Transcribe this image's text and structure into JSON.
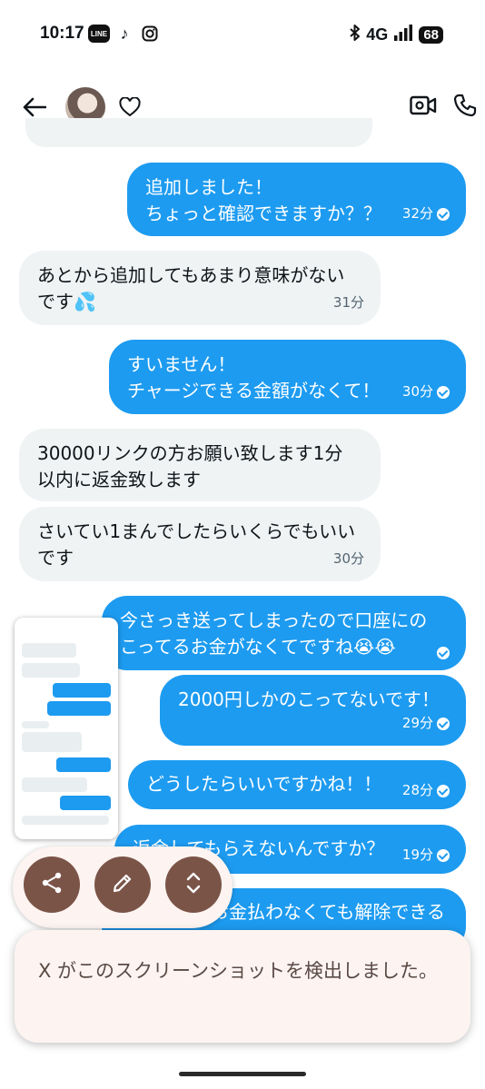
{
  "status_bar": {
    "time": "10:17",
    "apps": [
      "LINE",
      "TikTok",
      "Instagram"
    ],
    "line_label": "LINE",
    "tiktok_glyph": "♪",
    "network": "4G",
    "battery": "68"
  },
  "header": {
    "icons": [
      "back-arrow-icon",
      "heart-icon",
      "video-call-icon",
      "phone-icon"
    ]
  },
  "messages": [
    {
      "dir": "out",
      "text": "追加しました！\nちょっと確認できますか？？",
      "time": "32分",
      "read": true
    },
    {
      "dir": "in",
      "text": "あとから追加してもあまり意味がない\nです💦",
      "time": "31分"
    },
    {
      "dir": "out",
      "text": "すいません！\nチャージできる金額がなくて！",
      "time": "30分",
      "read": true
    },
    {
      "dir": "in",
      "text": "30000リンクの方お願い致します1分\n以内に返金致します",
      "time": ""
    },
    {
      "dir": "in",
      "text": "さいてい1まんでしたらいくらでもいい\nです",
      "time": "30分"
    },
    {
      "dir": "out",
      "text": "今さっき送ってしまったので口座にの\nこってるお金がなくてですね😭😭",
      "time": "",
      "read": true
    },
    {
      "dir": "out",
      "text": "2000円しかのこってないです！",
      "time": "29分",
      "read": true
    },
    {
      "dir": "out",
      "text": "どうしたらいいですかね！！",
      "time": "28分",
      "read": true
    },
    {
      "dir": "out",
      "text": "返金してもらえないんですか？",
      "time": "19分",
      "read": true
    },
    {
      "dir": "out",
      "text": "お金払わなくても解除できる",
      "time": ""
    }
  ],
  "screenshot_actions": {
    "buttons": [
      "share",
      "edit",
      "expand"
    ],
    "icons": [
      "share-icon",
      "pencil-icon",
      "expand-icon"
    ]
  },
  "toast": {
    "text": "X がこのスクリーンショットを検出しました。"
  },
  "colors": {
    "outgoing_bubble": "#1d9bf0",
    "incoming_bubble": "#eff3f4",
    "action_button": "#7b5448",
    "toast_bg": "#fdf4f1"
  }
}
